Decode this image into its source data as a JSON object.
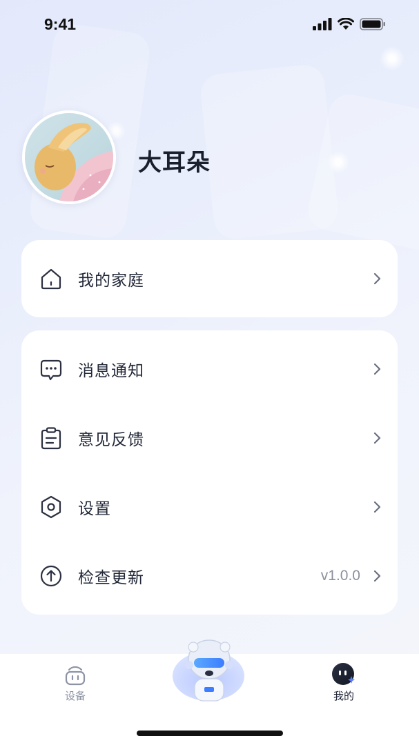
{
  "status_bar": {
    "time": "9:41",
    "icons": [
      "signal-icon",
      "wifi-icon",
      "battery-icon"
    ]
  },
  "profile": {
    "username": "大耳朵"
  },
  "menu_family": {
    "items": [
      {
        "label": "我的家庭",
        "icon": "house-icon"
      }
    ]
  },
  "menu_main": {
    "items": [
      {
        "label": "消息通知",
        "icon": "message-icon"
      },
      {
        "label": "意见反馈",
        "icon": "clipboard-icon"
      },
      {
        "label": "设置",
        "icon": "hexagon-settings-icon"
      },
      {
        "label": "检查更新",
        "icon": "upload-arrow-icon",
        "value": "v1.0.0"
      }
    ]
  },
  "tabbar": {
    "tabs": [
      {
        "label": "设备",
        "icon": "device-icon",
        "active": false
      },
      {
        "label": "",
        "icon": "robot-bear-mascot",
        "active": false
      },
      {
        "label": "我的",
        "icon": "profile-face-icon",
        "active": true
      }
    ]
  },
  "colors": {
    "accent": "#4f6ef7",
    "background": "#f3f5fb",
    "card": "#ffffff",
    "text": "#1d2233",
    "muted": "#8d93a3"
  }
}
